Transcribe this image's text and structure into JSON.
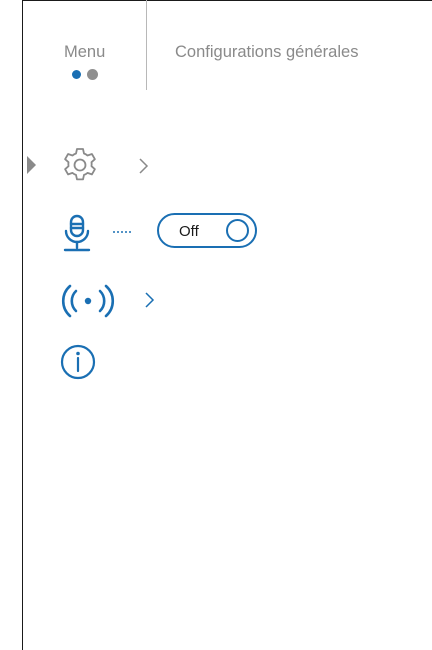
{
  "tabs": {
    "menu_label": "Menu",
    "general_label": "Configurations générales",
    "pagination": {
      "active_color": "#1a6fb3",
      "inactive_color": "#8f8f8f"
    }
  },
  "items": [
    {
      "icon": "gear-icon",
      "color": "#8a8a8a",
      "selected": true,
      "has_submenu": true
    },
    {
      "icon": "microphone-icon",
      "color": "#1a6fb3",
      "toggle": {
        "label": "Off",
        "state": "off"
      }
    },
    {
      "icon": "wireless-signal-icon",
      "color": "#1a6fb3",
      "has_submenu": true
    },
    {
      "icon": "info-icon",
      "color": "#1a6fb3"
    }
  ],
  "colors": {
    "accent": "#1a6fb3",
    "muted": "#8a8a8a",
    "frame": "#1a1a1a"
  }
}
